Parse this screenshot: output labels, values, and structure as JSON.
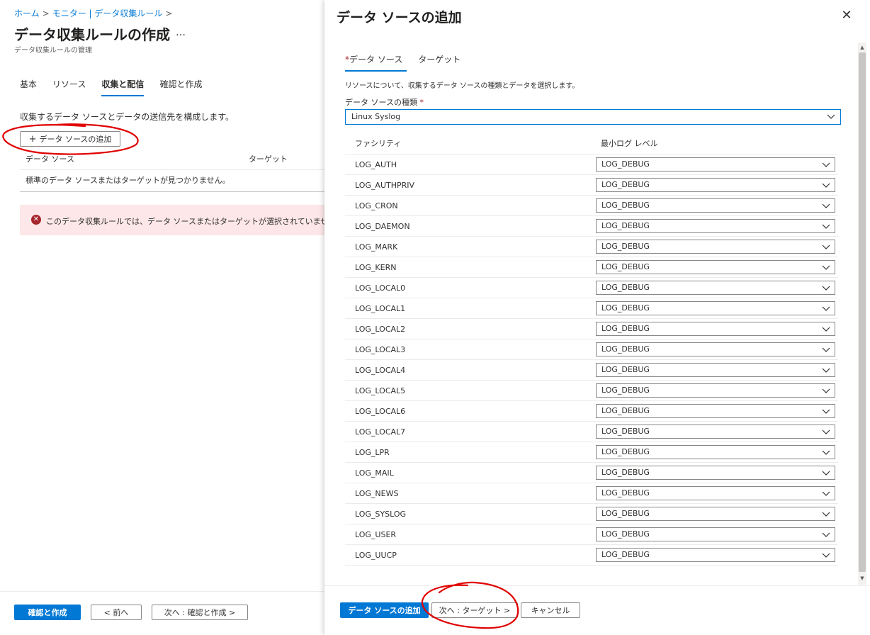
{
  "breadcrumb": {
    "items": [
      "ホーム",
      "モニター | データ収集ルール"
    ],
    "sep": ">"
  },
  "page": {
    "title": "データ収集ルールの作成",
    "more": "…",
    "subtitle": "データ収集ルールの管理"
  },
  "tabs": [
    {
      "label": "基本"
    },
    {
      "label": "リソース"
    },
    {
      "label": "収集と配信"
    },
    {
      "label": "確認と作成"
    }
  ],
  "collect": {
    "description": "収集するデータ ソースとデータの送信先を構成します。",
    "add_button": "データ ソースの追加",
    "add_plus": "+",
    "col_datasource": "データ ソース",
    "col_target": "ターゲット",
    "empty_text": "標準のデータ ソースまたはターゲットが見つかりません。",
    "error_text": "このデータ収集ルールでは、データ ソースまたはターゲットが選択されていません。"
  },
  "left_footer": {
    "review_create": "確認と作成",
    "prev": "< 前へ",
    "next": "次へ : 確認と作成 >"
  },
  "panel": {
    "title": "データ ソースの追加",
    "close": "✕",
    "tabs": [
      {
        "label": "データ ソース",
        "required": "*"
      },
      {
        "label": "ターゲット"
      }
    ],
    "description": "リソースについて、収集するデータ ソースの種類とデータを選択します。",
    "type_label": "データ ソースの種類",
    "type_required": "*",
    "type_value": "Linux Syslog",
    "col_facility": "ファシリティ",
    "col_level": "最小ログ レベル",
    "rows": [
      {
        "facility": "LOG_AUTH",
        "level": "LOG_DEBUG"
      },
      {
        "facility": "LOG_AUTHPRIV",
        "level": "LOG_DEBUG"
      },
      {
        "facility": "LOG_CRON",
        "level": "LOG_DEBUG"
      },
      {
        "facility": "LOG_DAEMON",
        "level": "LOG_DEBUG"
      },
      {
        "facility": "LOG_MARK",
        "level": "LOG_DEBUG"
      },
      {
        "facility": "LOG_KERN",
        "level": "LOG_DEBUG"
      },
      {
        "facility": "LOG_LOCAL0",
        "level": "LOG_DEBUG"
      },
      {
        "facility": "LOG_LOCAL1",
        "level": "LOG_DEBUG"
      },
      {
        "facility": "LOG_LOCAL2",
        "level": "LOG_DEBUG"
      },
      {
        "facility": "LOG_LOCAL3",
        "level": "LOG_DEBUG"
      },
      {
        "facility": "LOG_LOCAL4",
        "level": "LOG_DEBUG"
      },
      {
        "facility": "LOG_LOCAL5",
        "level": "LOG_DEBUG"
      },
      {
        "facility": "LOG_LOCAL6",
        "level": "LOG_DEBUG"
      },
      {
        "facility": "LOG_LOCAL7",
        "level": "LOG_DEBUG"
      },
      {
        "facility": "LOG_LPR",
        "level": "LOG_DEBUG"
      },
      {
        "facility": "LOG_MAIL",
        "level": "LOG_DEBUG"
      },
      {
        "facility": "LOG_NEWS",
        "level": "LOG_DEBUG"
      },
      {
        "facility": "LOG_SYSLOG",
        "level": "LOG_DEBUG"
      },
      {
        "facility": "LOG_USER",
        "level": "LOG_DEBUG"
      },
      {
        "facility": "LOG_UUCP",
        "level": "LOG_DEBUG"
      }
    ],
    "footer": {
      "add": "データ ソースの追加",
      "next": "次へ : ターゲット >",
      "cancel": "キャンセル"
    }
  },
  "colors": {
    "accent": "#0078d4",
    "error": "#a4262c",
    "error_bg": "#fde7e9",
    "annotation": "#e00000"
  },
  "icons": [
    "chevron-right-icon",
    "more-icon",
    "plus-icon",
    "error-circle-icon",
    "close-icon",
    "chevron-down-icon"
  ]
}
